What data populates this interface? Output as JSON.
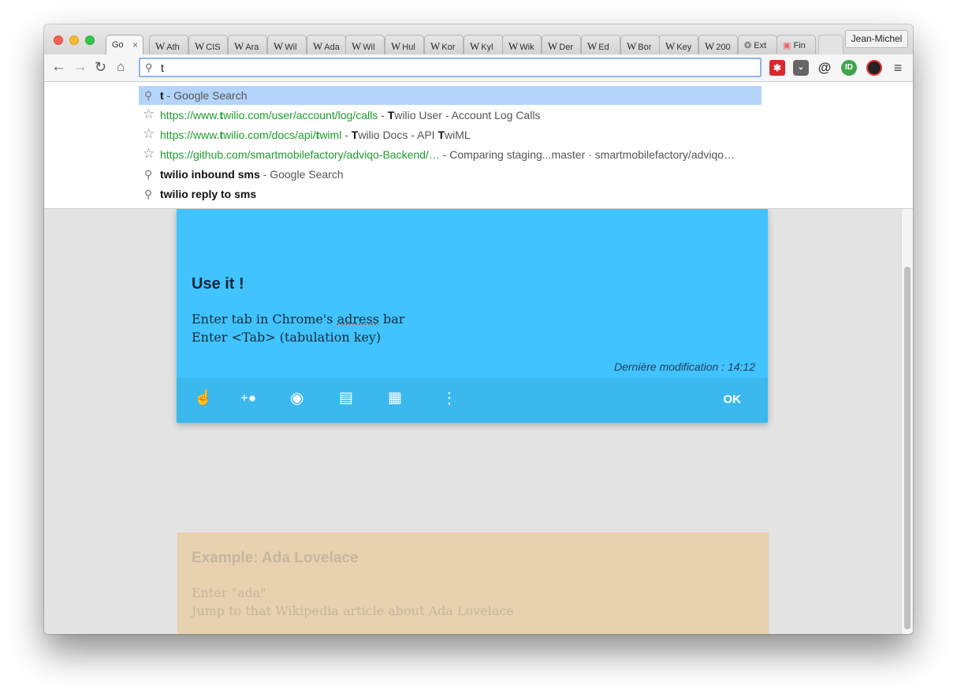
{
  "browser": {
    "profile_name": "Jean-Michel",
    "tabs": [
      {
        "label": "Go",
        "icon": "google-icon"
      },
      {
        "label": "Ath",
        "icon": "wikipedia-icon"
      },
      {
        "label": "CIS",
        "icon": "wikipedia-icon"
      },
      {
        "label": "Ara",
        "icon": "wikipedia-icon"
      },
      {
        "label": "Wil",
        "icon": "wikipedia-icon"
      },
      {
        "label": "Ada",
        "icon": "wikipedia-icon"
      },
      {
        "label": "Wil",
        "icon": "wikipedia-icon"
      },
      {
        "label": "Hul",
        "icon": "wikipedia-icon"
      },
      {
        "label": "Kor",
        "icon": "wikipedia-icon"
      },
      {
        "label": "Kyl",
        "icon": "wikipedia-icon"
      },
      {
        "label": "Wik",
        "icon": "wikipedia-icon"
      },
      {
        "label": "Der",
        "icon": "wikipedia-icon"
      },
      {
        "label": "Ed",
        "icon": "wikipedia-icon"
      },
      {
        "label": "Bor",
        "icon": "wikipedia-icon"
      },
      {
        "label": "Key",
        "icon": "wikipedia-icon"
      },
      {
        "label": "200",
        "icon": "wikipedia-icon"
      },
      {
        "label": "Ext",
        "icon": "puzzle-icon"
      },
      {
        "label": "Fin",
        "icon": "finder-icon"
      }
    ],
    "wiki_glyph": "W",
    "tab_close": "×",
    "omnibox_value": "t",
    "extensions": [
      "lastpass-icon",
      "pocket-icon",
      "at-icon",
      "idbooster-icon",
      "colorpicker-icon",
      "menu-icon"
    ]
  },
  "suggestions": [
    {
      "type": "search",
      "parts": [
        {
          "t": "t",
          "c": "bold"
        },
        {
          "t": " - Google Search",
          "c": ""
        }
      ]
    },
    {
      "type": "history",
      "parts": [
        {
          "t": "https://www.",
          "c": "url"
        },
        {
          "t": "t",
          "c": "url bold-g"
        },
        {
          "t": "wilio.com/user/account/log/calls",
          "c": "url"
        },
        {
          "t": " - ",
          "c": ""
        },
        {
          "t": "T",
          "c": "bold"
        },
        {
          "t": "wilio User - Account Log Calls",
          "c": ""
        }
      ]
    },
    {
      "type": "history",
      "parts": [
        {
          "t": "https://www.",
          "c": "url"
        },
        {
          "t": "t",
          "c": "url bold-g"
        },
        {
          "t": "wilio.com/docs/api/",
          "c": "url"
        },
        {
          "t": "t",
          "c": "url bold-g"
        },
        {
          "t": "wiml",
          "c": "url"
        },
        {
          "t": " - ",
          "c": ""
        },
        {
          "t": "T",
          "c": "bold"
        },
        {
          "t": "wilio Docs - API ",
          "c": ""
        },
        {
          "t": "T",
          "c": "bold"
        },
        {
          "t": "wiML",
          "c": ""
        }
      ]
    },
    {
      "type": "history",
      "parts": [
        {
          "t": "https://github.com/smartmobilefactory/adviqo-Backend/…",
          "c": "url"
        },
        {
          "t": " - Comparing staging...master · smartmobilefactory/adviqo…",
          "c": ""
        }
      ]
    },
    {
      "type": "search",
      "parts": [
        {
          "t": "twilio inbound sms",
          "c": "bold"
        },
        {
          "t": " - Google Search",
          "c": ""
        }
      ]
    },
    {
      "type": "search",
      "parts": [
        {
          "t": "twilio reply to sms",
          "c": "bold"
        }
      ]
    }
  ],
  "note_blue": {
    "title": "Use it !",
    "line1_a": "Enter tab in Chrome's ",
    "line1_spell": "adress",
    "line1_b": " bar",
    "line2": "Enter <Tab> (tabulation key)",
    "modified": "Dernière modification : 14:12",
    "ok_label": "OK",
    "toolbar_icons": [
      "remind-me-icon",
      "collaborator-icon",
      "palette-icon",
      "image-icon",
      "archive-icon",
      "more-icon"
    ],
    "color": "#40c3fe"
  },
  "note_orange": {
    "title": "Example: Ada Lovelace",
    "line1": "Enter \"ada\"",
    "line2": "Jump to that Wikipedia article about Ada Lovelace",
    "color": "#e8d1ae"
  }
}
